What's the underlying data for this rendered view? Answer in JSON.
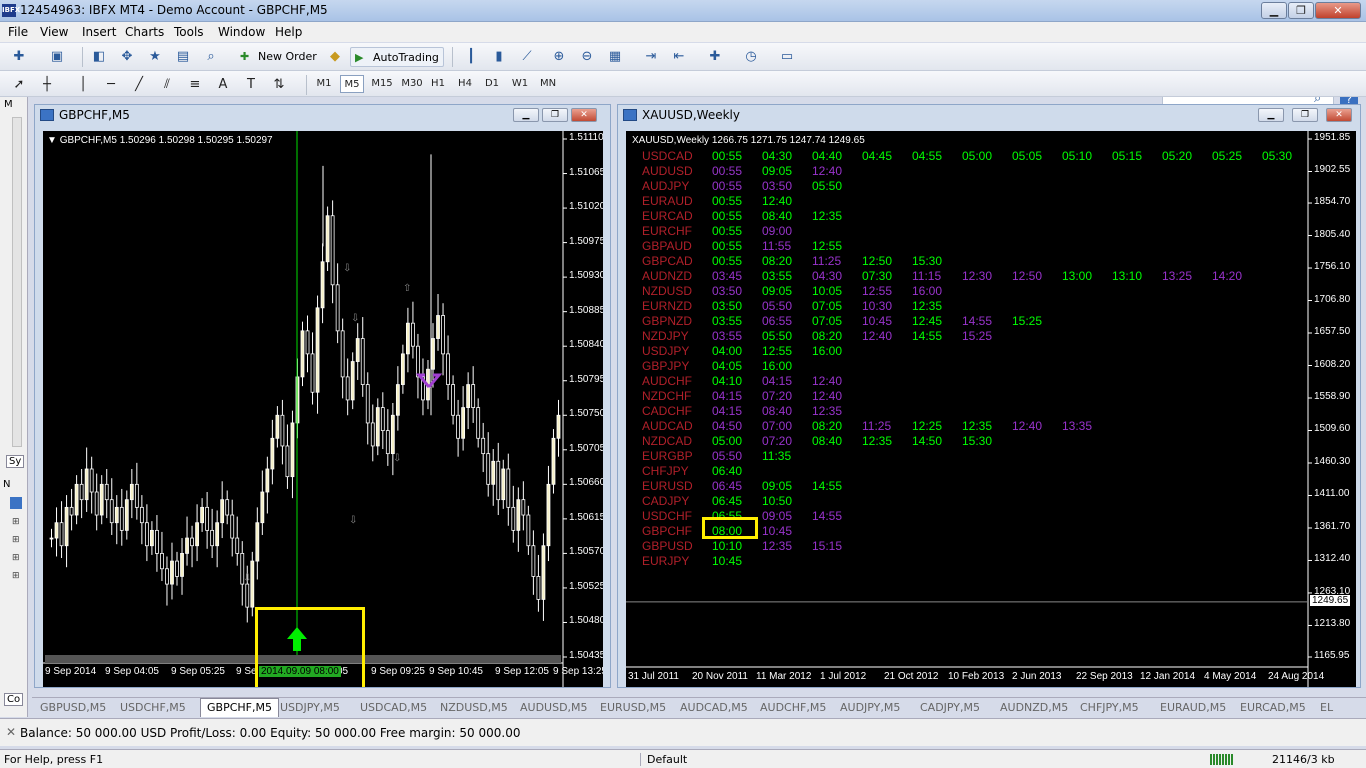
{
  "window": {
    "title": "12454963: IBFX MT4 - Demo Account - GBPCHF,M5",
    "logo_text": "IBFX",
    "min": "▁",
    "max": "❐",
    "close": "✕"
  },
  "menu": [
    "File",
    "View",
    "Insert",
    "Charts",
    "Tools",
    "Window",
    "Help"
  ],
  "toolbar": {
    "new_order": "New Order",
    "autotrading": "AutoTrading"
  },
  "timeframes": [
    {
      "label": "M1",
      "selected": false
    },
    {
      "label": "M5",
      "selected": true
    },
    {
      "label": "M15",
      "selected": false
    },
    {
      "label": "M30",
      "selected": false
    },
    {
      "label": "H1",
      "selected": false
    },
    {
      "label": "H4",
      "selected": false
    },
    {
      "label": "D1",
      "selected": false
    },
    {
      "label": "W1",
      "selected": false
    },
    {
      "label": "MN",
      "selected": false
    }
  ],
  "left_panel": {
    "tab1": "Sy",
    "tab2": "N",
    "tab3": "Co"
  },
  "chart1": {
    "title": "GBPCHF,M5",
    "header": "GBPCHF,M5  1.50296 1.50298 1.50295 1.50297",
    "price_labels": [
      "1.51110",
      "1.51065",
      "1.51020",
      "1.50975",
      "1.50930",
      "1.50885",
      "1.50840",
      "1.50795",
      "1.50750",
      "1.50705",
      "1.50660",
      "1.50615",
      "1.50570",
      "1.50525",
      "1.50480",
      "1.50435"
    ],
    "time_labels": [
      "9 Sep 2014",
      "9 Sep 04:05",
      "9 Sep 05:25",
      "9 Se",
      "05",
      "9 Sep 09:25",
      "9 Sep 10:45",
      "9 Sep 12:05",
      "9 Sep 13:25"
    ],
    "cursor_label": "2014.09.09 08:00",
    "price_scale": {
      "min": 1.50435,
      "max": 1.5111
    },
    "candles": [
      1.5059,
      1.5061,
      1.5058,
      1.5063,
      1.5062,
      1.5066,
      1.5064,
      1.5068,
      1.5065,
      1.5062,
      1.5066,
      1.5064,
      1.5061,
      1.5063,
      1.506,
      1.5064,
      1.5066,
      1.5063,
      1.5061,
      1.5058,
      1.506,
      1.5057,
      1.5055,
      1.5053,
      1.5056,
      1.5054,
      1.5057,
      1.5059,
      1.5058,
      1.5061,
      1.5063,
      1.506,
      1.5058,
      1.5061,
      1.5064,
      1.5062,
      1.5059,
      1.5057,
      1.5053,
      1.505,
      1.5056,
      1.5061,
      1.5065,
      1.5068,
      1.5072,
      1.5075,
      1.5071,
      1.5067,
      1.5074,
      1.508,
      1.5086,
      1.5083,
      1.5078,
      1.5089,
      1.5095,
      1.5101,
      1.5092,
      1.5086,
      1.508,
      1.5077,
      1.5082,
      1.5085,
      1.5079,
      1.5074,
      1.5071,
      1.5076,
      1.5073,
      1.507,
      1.5075,
      1.5079,
      1.5083,
      1.5087,
      1.5084,
      1.508,
      1.5077,
      1.5081,
      1.5085,
      1.5088,
      1.5083,
      1.5079,
      1.5075,
      1.5072,
      1.5076,
      1.5079,
      1.5076,
      1.5072,
      1.507,
      1.5066,
      1.5069,
      1.5064,
      1.5068,
      1.5063,
      1.506,
      1.5064,
      1.5062,
      1.5058,
      1.5054,
      1.5051,
      1.5058,
      1.5066,
      1.5072,
      1.5075
    ]
  },
  "chart2": {
    "title": "XAUUSD,Weekly",
    "header": "XAUUSD,Weekly  1266.75 1271.75 1247.74 1249.65",
    "price_labels": [
      "1951.85",
      "1902.55",
      "1854.70",
      "1805.40",
      "1756.10",
      "1706.80",
      "1657.50",
      "1608.20",
      "1558.90",
      "1509.60",
      "1460.30",
      "1411.00",
      "1361.70",
      "1312.40",
      "1263.10",
      "1213.80",
      "1165.95"
    ],
    "current_price": "1249.65",
    "time_labels": [
      "31 Jul 2011",
      "20 Nov 2011",
      "11 Mar 2012",
      "1 Jul 2012",
      "21 Oct 2012",
      "10 Feb 2013",
      "2 Jun 2013",
      "22 Sep 2013",
      "12 Jan 2014",
      "4 May 2014",
      "24 Aug 2014"
    ],
    "schedule": [
      {
        "pair": "USDCAD",
        "times": [
          {
            "t": "00:55",
            "c": "g"
          },
          {
            "t": "04:30",
            "c": "g"
          },
          {
            "t": "04:40",
            "c": "g"
          },
          {
            "t": "04:45",
            "c": "g"
          },
          {
            "t": "04:55",
            "c": "g"
          },
          {
            "t": "05:00",
            "c": "g"
          },
          {
            "t": "05:05",
            "c": "g"
          },
          {
            "t": "05:10",
            "c": "g"
          },
          {
            "t": "05:15",
            "c": "g"
          },
          {
            "t": "05:20",
            "c": "g"
          },
          {
            "t": "05:25",
            "c": "g"
          },
          {
            "t": "05:30",
            "c": "g"
          }
        ]
      },
      {
        "pair": "AUDUSD",
        "times": [
          {
            "t": "00:55",
            "c": "p"
          },
          {
            "t": "09:05",
            "c": "g"
          },
          {
            "t": "12:40",
            "c": "p"
          }
        ]
      },
      {
        "pair": "AUDJPY",
        "times": [
          {
            "t": "00:55",
            "c": "p"
          },
          {
            "t": "03:50",
            "c": "p"
          },
          {
            "t": "05:50",
            "c": "g"
          }
        ]
      },
      {
        "pair": "EURAUD",
        "times": [
          {
            "t": "00:55",
            "c": "g"
          },
          {
            "t": "12:40",
            "c": "g"
          }
        ]
      },
      {
        "pair": "EURCAD",
        "times": [
          {
            "t": "00:55",
            "c": "g"
          },
          {
            "t": "08:40",
            "c": "g"
          },
          {
            "t": "12:35",
            "c": "g"
          }
        ]
      },
      {
        "pair": "EURCHF",
        "times": [
          {
            "t": "00:55",
            "c": "g"
          },
          {
            "t": "09:00",
            "c": "p"
          }
        ]
      },
      {
        "pair": "GBPAUD",
        "times": [
          {
            "t": "00:55",
            "c": "g"
          },
          {
            "t": "11:55",
            "c": "p"
          },
          {
            "t": "12:55",
            "c": "g"
          }
        ]
      },
      {
        "pair": "GBPCAD",
        "times": [
          {
            "t": "00:55",
            "c": "g"
          },
          {
            "t": "08:20",
            "c": "g"
          },
          {
            "t": "11:25",
            "c": "p"
          },
          {
            "t": "12:50",
            "c": "g"
          },
          {
            "t": "15:30",
            "c": "g"
          }
        ]
      },
      {
        "pair": "AUDNZD",
        "times": [
          {
            "t": "03:45",
            "c": "p"
          },
          {
            "t": "03:55",
            "c": "g"
          },
          {
            "t": "04:30",
            "c": "p"
          },
          {
            "t": "07:30",
            "c": "g"
          },
          {
            "t": "11:15",
            "c": "p"
          },
          {
            "t": "12:30",
            "c": "p"
          },
          {
            "t": "12:50",
            "c": "p"
          },
          {
            "t": "13:00",
            "c": "g"
          },
          {
            "t": "13:10",
            "c": "g"
          },
          {
            "t": "13:25",
            "c": "p"
          },
          {
            "t": "14:20",
            "c": "p"
          }
        ]
      },
      {
        "pair": "NZDUSD",
        "times": [
          {
            "t": "03:50",
            "c": "p"
          },
          {
            "t": "09:05",
            "c": "g"
          },
          {
            "t": "10:05",
            "c": "g"
          },
          {
            "t": "12:55",
            "c": "p"
          },
          {
            "t": "16:00",
            "c": "p"
          }
        ]
      },
      {
        "pair": "EURNZD",
        "times": [
          {
            "t": "03:50",
            "c": "g"
          },
          {
            "t": "05:50",
            "c": "p"
          },
          {
            "t": "07:05",
            "c": "g"
          },
          {
            "t": "10:30",
            "c": "p"
          },
          {
            "t": "12:35",
            "c": "g"
          }
        ]
      },
      {
        "pair": "GBPNZD",
        "times": [
          {
            "t": "03:55",
            "c": "g"
          },
          {
            "t": "06:55",
            "c": "p"
          },
          {
            "t": "07:05",
            "c": "g"
          },
          {
            "t": "10:45",
            "c": "p"
          },
          {
            "t": "12:45",
            "c": "g"
          },
          {
            "t": "14:55",
            "c": "p"
          },
          {
            "t": "15:25",
            "c": "g"
          }
        ]
      },
      {
        "pair": "NZDJPY",
        "times": [
          {
            "t": "03:55",
            "c": "p"
          },
          {
            "t": "05:50",
            "c": "g"
          },
          {
            "t": "08:20",
            "c": "g"
          },
          {
            "t": "12:40",
            "c": "p"
          },
          {
            "t": "14:55",
            "c": "g"
          },
          {
            "t": "15:25",
            "c": "p"
          }
        ]
      },
      {
        "pair": "USDJPY",
        "times": [
          {
            "t": "04:00",
            "c": "g"
          },
          {
            "t": "12:55",
            "c": "g"
          },
          {
            "t": "16:00",
            "c": "g"
          }
        ]
      },
      {
        "pair": "GBPJPY",
        "times": [
          {
            "t": "04:05",
            "c": "g"
          },
          {
            "t": "16:00",
            "c": "g"
          }
        ]
      },
      {
        "pair": "AUDCHF",
        "times": [
          {
            "t": "04:10",
            "c": "g"
          },
          {
            "t": "04:15",
            "c": "p"
          },
          {
            "t": "12:40",
            "c": "p"
          }
        ]
      },
      {
        "pair": "NZDCHF",
        "times": [
          {
            "t": "04:15",
            "c": "p"
          },
          {
            "t": "07:20",
            "c": "p"
          },
          {
            "t": "12:40",
            "c": "p"
          }
        ]
      },
      {
        "pair": "CADCHF",
        "times": [
          {
            "t": "04:15",
            "c": "p"
          },
          {
            "t": "08:40",
            "c": "p"
          },
          {
            "t": "12:35",
            "c": "p"
          }
        ]
      },
      {
        "pair": "AUDCAD",
        "times": [
          {
            "t": "04:50",
            "c": "p"
          },
          {
            "t": "07:00",
            "c": "p"
          },
          {
            "t": "08:20",
            "c": "g"
          },
          {
            "t": "11:25",
            "c": "p"
          },
          {
            "t": "12:25",
            "c": "g"
          },
          {
            "t": "12:35",
            "c": "g"
          },
          {
            "t": "12:40",
            "c": "p"
          },
          {
            "t": "13:35",
            "c": "p"
          }
        ]
      },
      {
        "pair": "NZDCAD",
        "times": [
          {
            "t": "05:00",
            "c": "g"
          },
          {
            "t": "07:20",
            "c": "p"
          },
          {
            "t": "08:40",
            "c": "g"
          },
          {
            "t": "12:35",
            "c": "g"
          },
          {
            "t": "14:50",
            "c": "g"
          },
          {
            "t": "15:30",
            "c": "g"
          }
        ]
      },
      {
        "pair": "EURGBP",
        "times": [
          {
            "t": "05:50",
            "c": "p"
          },
          {
            "t": "11:35",
            "c": "g"
          }
        ]
      },
      {
        "pair": "CHFJPY",
        "times": [
          {
            "t": "06:40",
            "c": "g"
          }
        ]
      },
      {
        "pair": "EURUSD",
        "times": [
          {
            "t": "06:45",
            "c": "p"
          },
          {
            "t": "09:05",
            "c": "g"
          },
          {
            "t": "14:55",
            "c": "g"
          }
        ]
      },
      {
        "pair": "CADJPY",
        "times": [
          {
            "t": "06:45",
            "c": "g"
          },
          {
            "t": "10:50",
            "c": "g"
          }
        ]
      },
      {
        "pair": "USDCHF",
        "times": [
          {
            "t": "06:55",
            "c": "g"
          },
          {
            "t": "09:05",
            "c": "p"
          },
          {
            "t": "14:55",
            "c": "p"
          }
        ]
      },
      {
        "pair": "GBPCHF",
        "times": [
          {
            "t": "08:00",
            "c": "g"
          },
          {
            "t": "10:45",
            "c": "p"
          }
        ]
      },
      {
        "pair": "GBPUSD",
        "times": [
          {
            "t": "10:10",
            "c": "g"
          },
          {
            "t": "12:35",
            "c": "p"
          },
          {
            "t": "15:15",
            "c": "p"
          }
        ]
      },
      {
        "pair": "EURJPY",
        "times": [
          {
            "t": "10:45",
            "c": "g"
          }
        ]
      }
    ]
  },
  "tabs": [
    "GBPUSD,M5",
    "USDCHF,M5",
    "GBPCHF,M5",
    "USDJPY,M5",
    "USDCAD,M5",
    "NZDUSD,M5",
    "AUDUSD,M5",
    "EURUSD,M5",
    "AUDCAD,M5",
    "AUDCHF,M5",
    "AUDJPY,M5",
    "CADJPY,M5",
    "AUDNZD,M5",
    "CHFJPY,M5",
    "EURAUD,M5",
    "EURCAD,M5",
    "EL"
  ],
  "active_tab": "GBPCHF,M5",
  "balance": "Balance: 50 000.00 USD  Profit/Loss: 0.00  Equity: 50 000.00  Free margin: 50 000.00",
  "status": {
    "help": "For Help, press F1",
    "profile": "Default",
    "traffic": "21146/3 kb"
  },
  "colors": {
    "green": "#00ff00",
    "purple": "#9933cc",
    "pair_red": "#b0202a",
    "highlight": "#ffee00",
    "chart_bg": "#000000",
    "candle": "#ffffff"
  }
}
